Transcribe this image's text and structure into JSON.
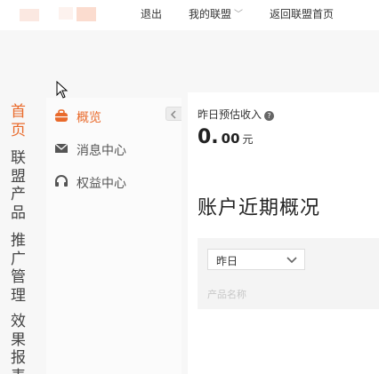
{
  "header": {
    "logout": "退出",
    "my_union": "我的联盟",
    "back_home": "返回联盟首页"
  },
  "left_nav": {
    "items": [
      {
        "label": [
          "首",
          "页"
        ]
      },
      {
        "label": [
          "联",
          "盟",
          "产",
          "品"
        ]
      },
      {
        "label": [
          "推",
          "广",
          "管",
          "理"
        ]
      },
      {
        "label": [
          "效",
          "果",
          "报",
          "表"
        ]
      }
    ],
    "active_color": "#e96a2b"
  },
  "sidebar": {
    "items": [
      {
        "label": "概览",
        "icon": "briefcase-icon",
        "active": true
      },
      {
        "label": "消息中心",
        "icon": "mail-icon",
        "active": false
      },
      {
        "label": "权益中心",
        "icon": "headset-icon",
        "active": false
      }
    ]
  },
  "main": {
    "estimate_label": "昨日预估收入",
    "estimate_int": "0.",
    "estimate_dec": "00",
    "estimate_unit": "元",
    "section_title": "账户近期概况",
    "period_select": "昨日",
    "product_name_label": "产品名称"
  }
}
